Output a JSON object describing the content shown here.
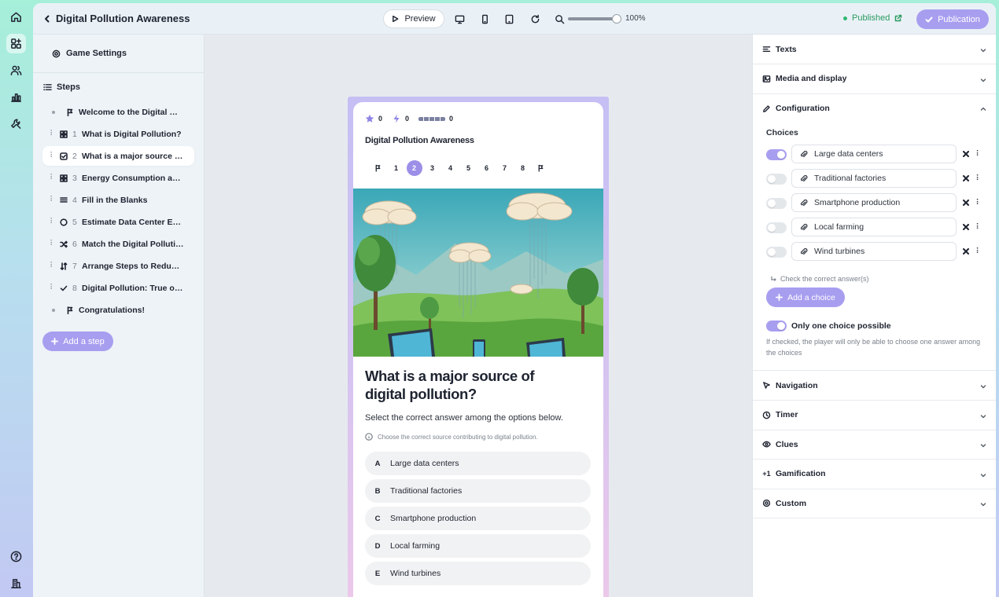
{
  "app": {
    "title": "Digital Pollution Awareness",
    "preview_label": "Preview",
    "zoom": {
      "value": 100,
      "label": "100%"
    },
    "status": "Published",
    "publication_label": "Publication",
    "accent_color": "#a89ef0",
    "published_color": "#2a9a62"
  },
  "rail": {
    "items": [
      {
        "name": "home-icon",
        "active": false
      },
      {
        "name": "editor-icon",
        "active": true
      },
      {
        "name": "users-icon",
        "active": false
      },
      {
        "name": "stats-icon",
        "active": false
      },
      {
        "name": "tools-icon",
        "active": false
      },
      {
        "name": "help-icon",
        "active": false
      },
      {
        "name": "organization-icon",
        "active": false
      }
    ]
  },
  "sidebar": {
    "game_settings": "Game Settings",
    "steps_heading": "Steps",
    "add_step": "Add a step",
    "steps": [
      {
        "num": "",
        "label": "Welcome to the Digital Pollu...",
        "icon": "flag-icon",
        "kind": "bullet"
      },
      {
        "num": "1",
        "label": "What is Digital Pollution?",
        "icon": "grid-icon",
        "kind": "drag"
      },
      {
        "num": "2",
        "label": "What is a major source of ...",
        "icon": "checkbox-icon",
        "kind": "drag"
      },
      {
        "num": "3",
        "label": "Energy Consumption and ...",
        "icon": "grid-icon",
        "kind": "drag"
      },
      {
        "num": "4",
        "label": "Fill in the Blanks",
        "icon": "text-lines-icon",
        "kind": "drag"
      },
      {
        "num": "5",
        "label": "Estimate Data Center Ene...",
        "icon": "dashed-circle-icon",
        "kind": "drag"
      },
      {
        "num": "6",
        "label": "Match the Digital Pollutio...",
        "icon": "shuffle-icon",
        "kind": "drag"
      },
      {
        "num": "7",
        "label": "Arrange Steps to Reduce ...",
        "icon": "sort-icon",
        "kind": "drag"
      },
      {
        "num": "8",
        "label": "Digital Pollution: True or F...",
        "icon": "check-icon",
        "kind": "drag"
      },
      {
        "num": "",
        "label": "Congratulations!",
        "icon": "flag-icon",
        "kind": "bullet"
      }
    ],
    "active_index": 2
  },
  "preview": {
    "hud": {
      "stars": "0",
      "energy": "0",
      "progress": "0"
    },
    "game_title": "Digital Pollution Awareness",
    "step_nav": [
      "1",
      "2",
      "3",
      "4",
      "5",
      "6",
      "7",
      "8"
    ],
    "current_step": "2",
    "question": "What is a major source of digital pollution?",
    "instruction": "Select the correct answer among the options below.",
    "hint": "Choose the correct source contributing to digital pollution.",
    "options": [
      {
        "letter": "A",
        "text": "Large data centers"
      },
      {
        "letter": "B",
        "text": "Traditional factories"
      },
      {
        "letter": "C",
        "text": "Smartphone production"
      },
      {
        "letter": "D",
        "text": "Local farming"
      },
      {
        "letter": "E",
        "text": "Wind turbines"
      }
    ]
  },
  "config": {
    "sections_top": [
      {
        "title": "Texts",
        "icon": "text-align-icon"
      },
      {
        "title": "Media and display",
        "icon": "image-icon"
      },
      {
        "title": "Configuration",
        "icon": "pencil-icon"
      }
    ],
    "choices_label": "Choices",
    "choices": [
      {
        "text": "Large data centers",
        "correct": true
      },
      {
        "text": "Traditional factories",
        "correct": false
      },
      {
        "text": "Smartphone production",
        "correct": false
      },
      {
        "text": "Local farming",
        "correct": false
      },
      {
        "text": "Wind turbines",
        "correct": false
      }
    ],
    "check_correct": "Check the correct answer(s)",
    "add_choice": "Add a choice",
    "only_one": {
      "label": "Only one choice possible",
      "enabled": true,
      "help": "If checked, the player will only be able to choose one answer among the choices"
    },
    "sections_bottom": [
      {
        "title": "Navigation",
        "icon": "navigation-icon"
      },
      {
        "title": "Timer",
        "icon": "clock-icon"
      },
      {
        "title": "Clues",
        "icon": "eye-icon"
      },
      {
        "title": "Gamification",
        "icon": "plus-one-icon",
        "glyph": "+1"
      },
      {
        "title": "Custom",
        "icon": "settings-icon"
      }
    ]
  }
}
